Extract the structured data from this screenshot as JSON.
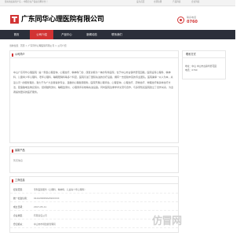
{
  "topbar": {
    "left": "您好欢迎来到广东... 中国企业产品信息网平台 ！",
    "links": [
      "设为首页",
      "立即注册",
      "产品列表",
      "企业列表"
    ]
  },
  "header": {
    "company": "广东同华心理医院有限公司",
    "hotline_label": "联系电话",
    "hotline_number": "0760"
  },
  "nav": {
    "items": [
      "首页",
      "公司介绍",
      "产品中心",
      "新闻动态",
      "联系我们"
    ]
  },
  "breadcrumb": "当前位置：首页 > 广东同华心理医院有限公司 > 公司介绍",
  "intro": {
    "title": "公司简介",
    "text": "中山广东同华心理医院 “是一家集心理咨询、心理治疗、精神科门诊、康复训练为一体的专科医院，位于中山市古镇华碧花园路，医院设有心理科、精神科、儿童青少年心理科、老年心理科、睡眠障碍科等多个科室，医院引进了国际先进的诊疗设备，拥有一支经验丰富的专业团队。医院秉承 “以人为本，关爱心灵” 的服务理念，致力于为广大患者提供专业、温馨的心理健康服务。医院开展心理评估、心理咨询、心理治疗、药物治疗、物理治疗等多种治疗方法，配备脑电生物反馈仪、经颅磁刺激仪、睡眠监测仪、心理测评系统等先进设备。同时医院注重学术交流与合作，与多家知名医院建立了合作关系，为患者提供更好的医疗服务。"
  },
  "sidebar": {
    "title": "联系方式",
    "lines": [
      "地址：中山 中山市古镇华碧花园",
      "电话：0760"
    ]
  },
  "news": {
    "title": "最新产品",
    "empty": "暂无信息"
  },
  "business": {
    "title": "工商信息",
    "rows": [
      {
        "k": "经营范围：",
        "v": "专科医院服务（心理科、精神科、儿童青少年心理科）"
      },
      {
        "k": "统一社会信用：",
        "v": "91442000MA4W0XXXX"
      },
      {
        "k": "成立日期：",
        "v": "2017-05-11"
      },
      {
        "k": "企业类型：",
        "v": "有限责任公司"
      },
      {
        "k": "登记机关：",
        "v": "中山市市场监督管理局"
      }
    ]
  },
  "watermark": "仿冒网"
}
